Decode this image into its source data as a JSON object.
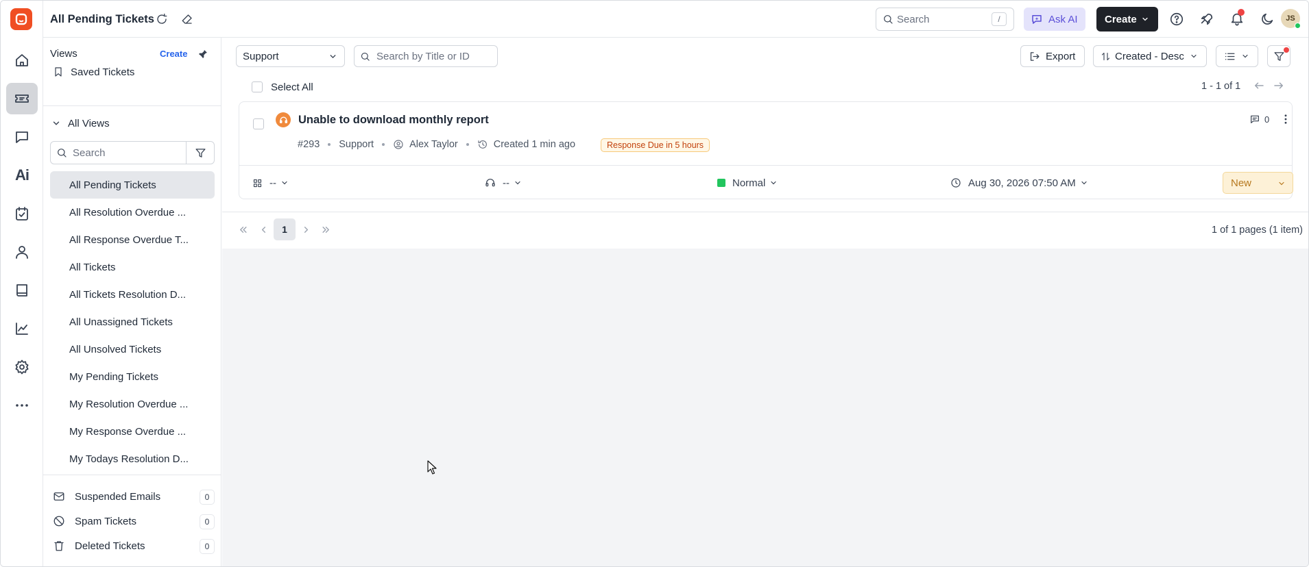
{
  "header": {
    "title": "All Pending Tickets",
    "search_placeholder": "Search",
    "search_shortcut": "/",
    "ask_ai_label": "Ask AI",
    "create_label": "Create",
    "avatar_initials": "JS"
  },
  "views_sidebar": {
    "heading": "Views",
    "create_label": "Create",
    "saved_label": "Saved Tickets",
    "all_views_label": "All Views",
    "search_placeholder": "Search",
    "items": [
      {
        "label": "All Pending Tickets",
        "active": true
      },
      {
        "label": "All Resolution Overdue ..."
      },
      {
        "label": "All Response Overdue T..."
      },
      {
        "label": "All Tickets"
      },
      {
        "label": "All Tickets Resolution D..."
      },
      {
        "label": "All Unassigned Tickets"
      },
      {
        "label": "All Unsolved Tickets"
      },
      {
        "label": "My Pending Tickets"
      },
      {
        "label": "My Resolution Overdue ..."
      },
      {
        "label": "My Response Overdue ..."
      },
      {
        "label": "My Todays Resolution D..."
      }
    ],
    "bottom": [
      {
        "label": "Suspended Emails",
        "count": "0"
      },
      {
        "label": "Spam Tickets",
        "count": "0"
      },
      {
        "label": "Deleted Tickets",
        "count": "0"
      }
    ]
  },
  "toolbar": {
    "team_select": "Support",
    "search_placeholder": "Search by Title or ID",
    "export_label": "Export",
    "sort_label": "Created - Desc",
    "select_all_label": "Select All",
    "range_label": "1 - 1 of 1"
  },
  "ticket": {
    "title": "Unable to download monthly report",
    "id": "#293",
    "team": "Support",
    "contact": "Alex Taylor",
    "created": "Created 1 min ago",
    "sla_badge": "Response Due in 5 hours",
    "comments": "0",
    "type_value": "--",
    "agent_value": "--",
    "priority": "Normal",
    "priority_color": "#22c55e",
    "due_date": "Aug 30, 2026 07:50 AM",
    "status": "New",
    "status_bg": "#fdf1d7",
    "status_color": "#b7791f"
  },
  "pagination": {
    "current_page": "1",
    "summary": "1 of 1 pages (1 item)"
  },
  "colors": {
    "brand": "#f04e23",
    "accent": "#2563eb",
    "notification": "#ef4444"
  }
}
